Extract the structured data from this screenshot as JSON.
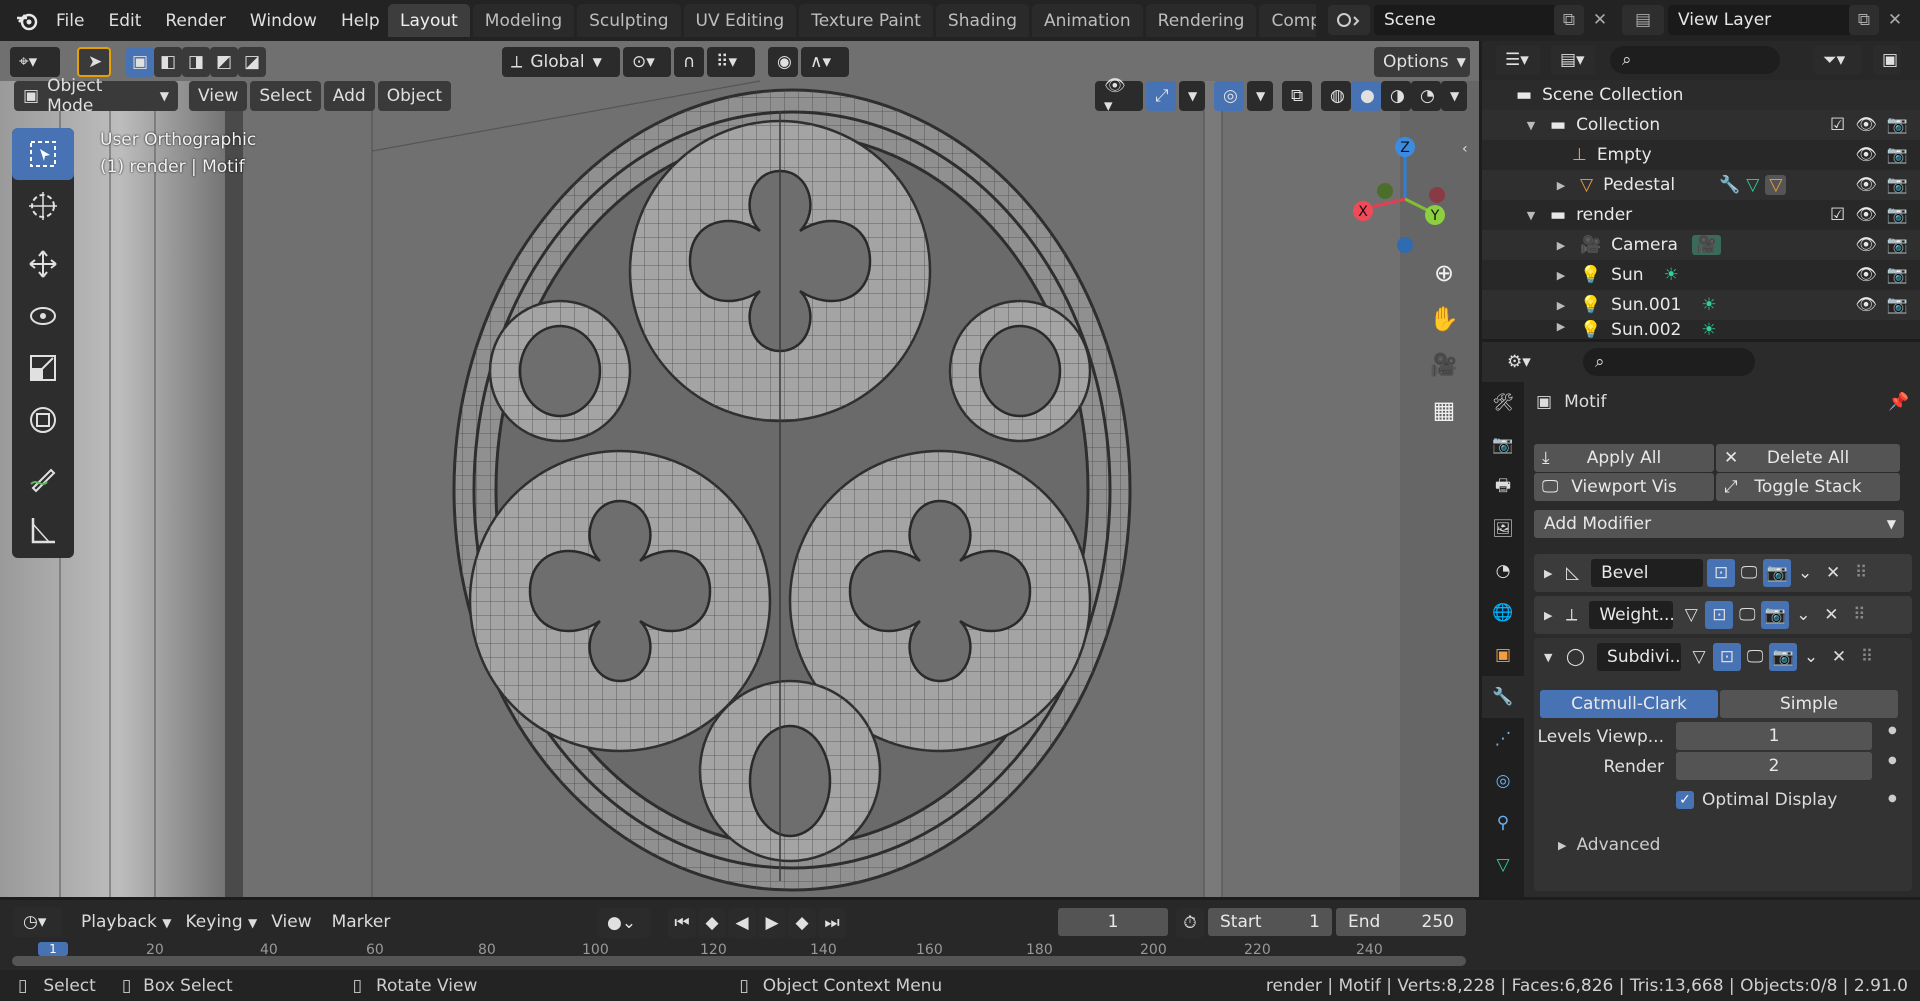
{
  "menubar": {
    "items": [
      "File",
      "Edit",
      "Render",
      "Window",
      "Help"
    ]
  },
  "workspaces": {
    "tabs": [
      "Layout",
      "Modeling",
      "Sculpting",
      "UV Editing",
      "Texture Paint",
      "Shading",
      "Animation",
      "Rendering",
      "Compos"
    ],
    "active": "Layout"
  },
  "scene": {
    "label": "Scene"
  },
  "view_layer": {
    "label": "View Layer"
  },
  "viewport": {
    "orientation": "Global",
    "options_label": "Options",
    "mode": "Object Mode",
    "menus": [
      "View",
      "Select",
      "Add",
      "Object"
    ],
    "overlay_line1": "User Orthographic",
    "overlay_line2": "(1) render | Motif",
    "gizmo": {
      "x": "X",
      "y": "Y",
      "z": "Z"
    }
  },
  "outliner": {
    "rows": [
      {
        "name": "Scene Collection",
        "level": 0
      },
      {
        "name": "Collection",
        "level": 1
      },
      {
        "name": "Empty",
        "level": 2
      },
      {
        "name": "Pedestal",
        "level": 2
      },
      {
        "name": "render",
        "level": 1
      },
      {
        "name": "Camera",
        "level": 2
      },
      {
        "name": "Sun",
        "level": 2
      },
      {
        "name": "Sun.001",
        "level": 2
      },
      {
        "name": "Sun.002",
        "level": 2
      }
    ]
  },
  "properties": {
    "object_name": "Motif",
    "apply_all": "Apply All",
    "delete_all": "Delete All",
    "viewport_vis": "Viewport Vis",
    "toggle_stack": "Toggle Stack",
    "add_modifier": "Add Modifier",
    "modifiers": [
      {
        "name": "Bevel",
        "expanded": false
      },
      {
        "name": "Weight...",
        "expanded": false
      },
      {
        "name": "Subdivi...",
        "expanded": true
      }
    ],
    "subdiv": {
      "catmull": "Catmull-Clark",
      "simple": "Simple",
      "levels_label": "Levels Viewp...",
      "levels_value": "1",
      "render_label": "Render",
      "render_value": "2",
      "optimal_label": "Optimal Display",
      "optimal_checked": true,
      "advanced_label": "Advanced"
    }
  },
  "timeline": {
    "menus": [
      "Playback",
      "Keying",
      "View",
      "Marker"
    ],
    "current_frame": "1",
    "start_label": "Start",
    "start_value": "1",
    "end_label": "End",
    "end_value": "250",
    "ruler": [
      "1",
      "20",
      "40",
      "60",
      "80",
      "100",
      "120",
      "140",
      "160",
      "180",
      "200",
      "220",
      "240"
    ]
  },
  "status": {
    "select": "Select",
    "box_select": "Box Select",
    "rotate_view": "Rotate View",
    "context_menu": "Object Context Menu",
    "stats": "render | Motif | Verts:8,228 | Faces:6,826 | Tris:13,668 | Objects:0/8 | 2.91.0"
  },
  "colors": {
    "accent": "#4772b3",
    "bg_dark": "#1d1d1d",
    "panel": "#2b2b2b",
    "viewport": "#6e6e6e"
  }
}
